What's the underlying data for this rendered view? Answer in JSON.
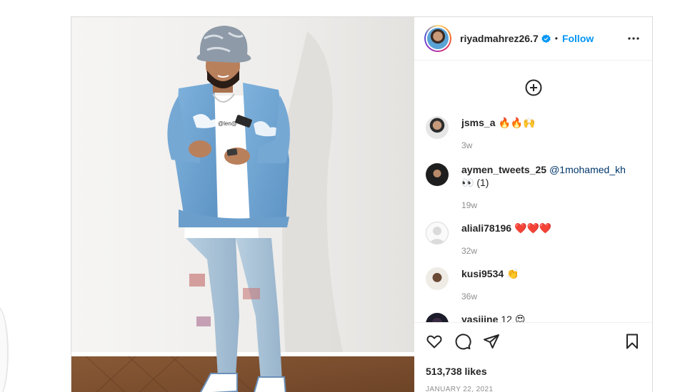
{
  "post": {
    "author": "riyadmahrez26.7",
    "separator": "•",
    "follow_label": "Follow",
    "photo_shirt_text": "@len@"
  },
  "comments": [
    {
      "user": "jsms_a",
      "text": "🔥🔥🙌",
      "time": "3w"
    },
    {
      "user": "aymen_tweets_25",
      "mention": "@1mohamed_kh",
      "text": "👀 (1)",
      "time": "19w"
    },
    {
      "user": "aliali78196",
      "text": "❤️❤️❤️",
      "time": "32w"
    },
    {
      "user": "kusi9534",
      "text": "👏",
      "time": "36w"
    },
    {
      "user": "yasiiine",
      "text": "12 😍",
      "time": ""
    }
  ],
  "stats": {
    "likes": "513,738 likes",
    "date": "JANUARY 22, 2021"
  },
  "colors": {
    "accent": "#0095f6",
    "mention": "#00376b",
    "muted": "#8e8e8e",
    "border": "#dbdbdb"
  },
  "icons": [
    "more-options-icon",
    "add-comment-icon",
    "heart-icon",
    "comment-icon",
    "share-icon",
    "bookmark-icon",
    "verified-badge-icon"
  ]
}
